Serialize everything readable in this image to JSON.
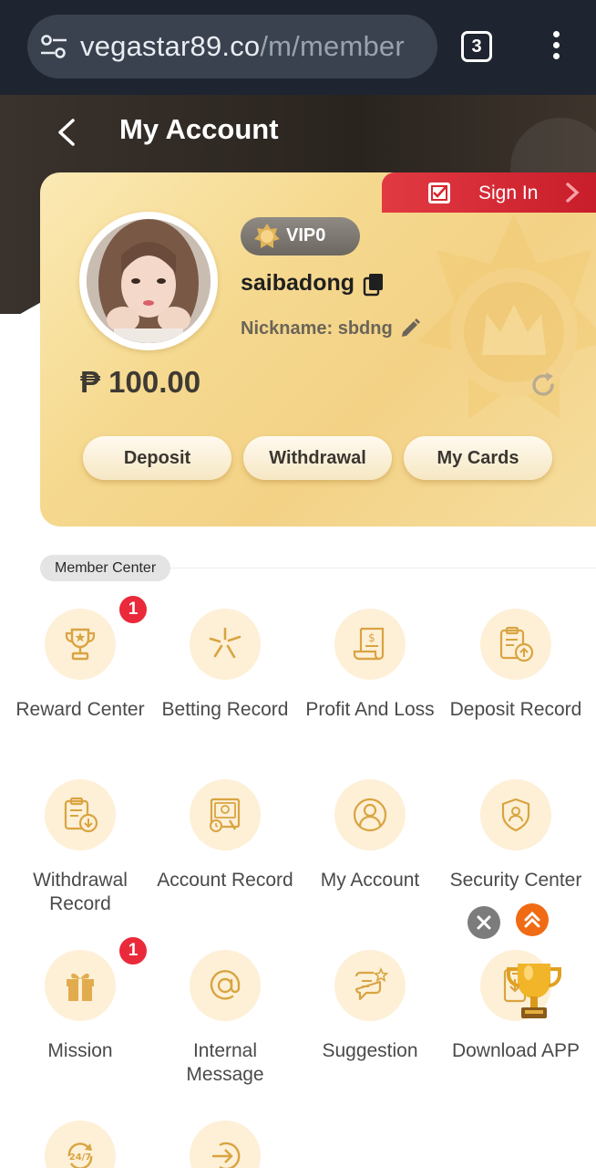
{
  "browser": {
    "url_main": "vegastar89.co",
    "url_rest": "/m/member",
    "tab_count": "3"
  },
  "header": {
    "title": "My Account"
  },
  "account": {
    "sign_in_label": "Sign In",
    "vip_level": "VIP0",
    "username": "saibadong",
    "nickname": "Nickname: sbdng",
    "balance": "₱ 100.00",
    "buttons": {
      "deposit": "Deposit",
      "withdrawal": "Withdrawal",
      "my_cards": "My Cards"
    }
  },
  "member_center": {
    "title": "Member Center",
    "items": [
      {
        "label": "Reward Center",
        "icon": "trophy-icon",
        "badge": "1"
      },
      {
        "label": "Betting Record",
        "icon": "betting-icon",
        "badge": ""
      },
      {
        "label": "Profit And Loss",
        "icon": "receipt-icon",
        "badge": ""
      },
      {
        "label": "Deposit Record",
        "icon": "clipboard-upload-icon",
        "badge": ""
      },
      {
        "label": "Withdrawal Record",
        "icon": "clipboard-download-icon",
        "badge": ""
      },
      {
        "label": "Account Record",
        "icon": "account-record-icon",
        "badge": ""
      },
      {
        "label": "My Account",
        "icon": "user-icon",
        "badge": ""
      },
      {
        "label": "Security Center",
        "icon": "shield-user-icon",
        "badge": ""
      },
      {
        "label": "Mission",
        "icon": "gift-icon",
        "badge": "1"
      },
      {
        "label": "Internal Message",
        "icon": "at-icon",
        "badge": ""
      },
      {
        "label": "Suggestion",
        "icon": "chat-star-icon",
        "badge": ""
      },
      {
        "label": "Download APP",
        "icon": "download-app-icon",
        "badge": ""
      },
      {
        "label": "",
        "icon": "support-24-7-icon",
        "badge": ""
      },
      {
        "label": "",
        "icon": "logout-icon",
        "badge": ""
      }
    ]
  },
  "colors": {
    "browser_bg": "#1e2530",
    "card_gold": "#f3d286",
    "signin_red": "#d8262f",
    "icon_gold": "#d9a441",
    "badge_red": "#ea2a3a"
  }
}
